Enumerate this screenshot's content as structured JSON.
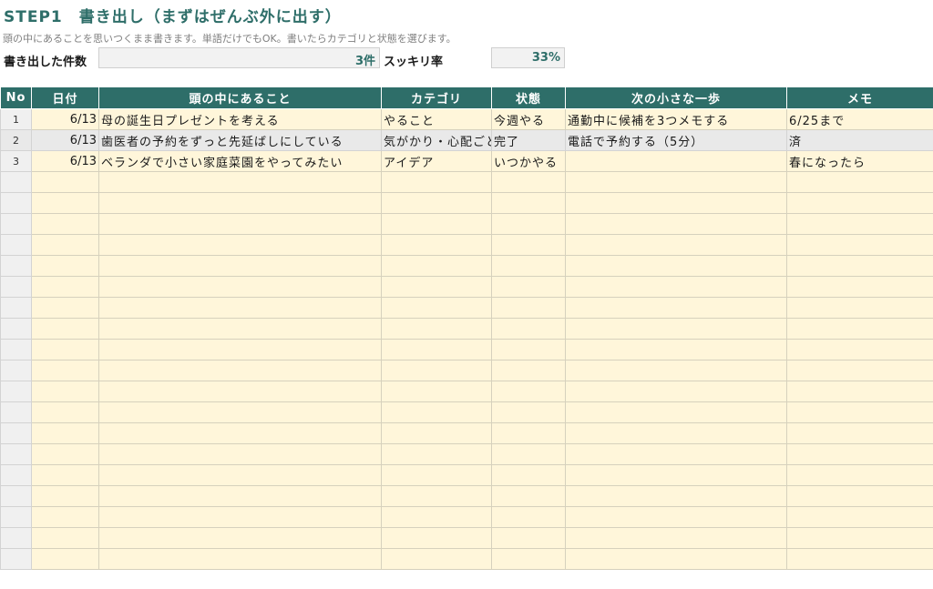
{
  "header": {
    "title": "STEP1　書き出し（まずはぜんぶ外に出す）",
    "subtitle": "頭の中にあることを思いつくまま書きます。単語だけでもOK。書いたらカテゴリと状態を選びます。"
  },
  "stats": {
    "count_label": "書き出した件数",
    "count_value": "3件",
    "rate_label": "スッキリ率",
    "rate_value": "33%"
  },
  "table": {
    "columns": [
      "No",
      "日付",
      "頭の中にあること",
      "カテゴリ",
      "状態",
      "次の小さな一歩",
      "メモ"
    ],
    "rows": [
      {
        "no": "1",
        "date": "6/13",
        "item": "母の誕生日プレゼントを考える",
        "category": "やること",
        "status": "今週やる",
        "next": "通勤中に候補を3つメモする",
        "memo": "6/25まで"
      },
      {
        "no": "2",
        "date": "6/13",
        "item": "歯医者の予約をずっと先延ばしにしている",
        "category": "気がかり・心配ごと",
        "status": "完了",
        "next": "電話で予約する（5分）",
        "memo": "済"
      },
      {
        "no": "3",
        "date": "6/13",
        "item": "ベランダで小さい家庭菜園をやってみたい",
        "category": "アイデア",
        "status": "いつかやる",
        "next": "",
        "memo": "春になったら"
      }
    ],
    "empty_row_count": 19
  },
  "colors": {
    "accent": "#2e6e69",
    "row_fill": "#fff6da",
    "alt_row_fill": "#e9e9e9"
  }
}
